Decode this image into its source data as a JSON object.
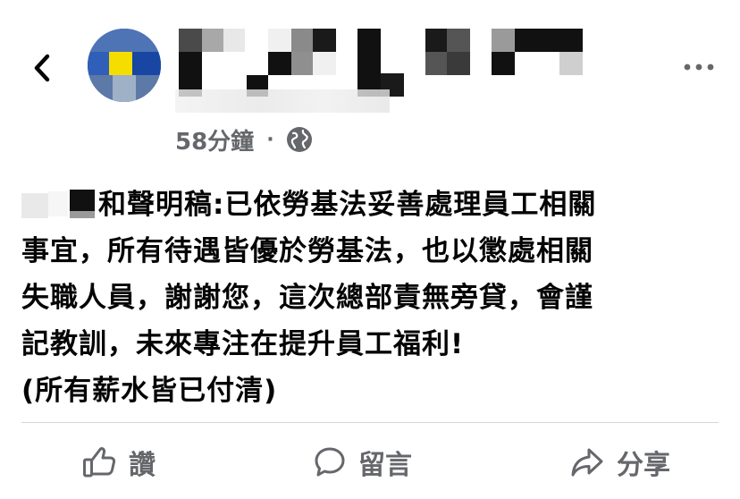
{
  "header": {
    "back_icon": "chevron-left-icon",
    "more_icon": "more-horizontal-icon"
  },
  "post": {
    "timestamp": "58分鐘",
    "separator": "·",
    "audience_icon": "globe-icon",
    "body_lines": [
      "和聲明稿:已依勞基法妥善處理員工相關",
      "事宜，所有待遇皆優於勞基法，也以懲處相關",
      "失職人員，謝謝您，這次總部責無旁貸，會謹",
      "記教訓，未來專注在提升員工福利!",
      "(所有薪水皆已付清)"
    ]
  },
  "actions": {
    "like_label": "讚",
    "comment_label": "留言",
    "share_label": "分享",
    "like_icon": "thumbs-up-icon",
    "comment_icon": "comment-bubble-icon",
    "share_icon": "share-arrow-icon"
  },
  "colors": {
    "text": "#050505",
    "secondary": "#65676b",
    "divider": "#d7d7d7"
  }
}
